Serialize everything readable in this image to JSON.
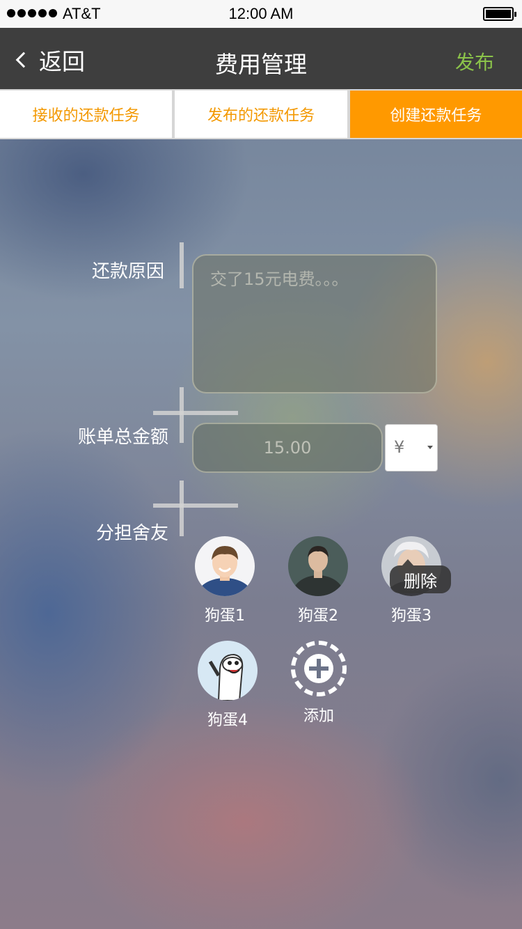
{
  "status_bar": {
    "carrier": "AT&T",
    "time": "12:00 AM"
  },
  "nav": {
    "back_label": "返回",
    "title": "费用管理",
    "publish_label": "发布"
  },
  "tabs": [
    {
      "label": "接收的还款任务",
      "active": false
    },
    {
      "label": "发布的还款任务",
      "active": false
    },
    {
      "label": "创建还款任务",
      "active": true
    }
  ],
  "form": {
    "reason_label": "还款原因",
    "reason_placeholder": "交了15元电费。。。",
    "amount_label": "账单总金额",
    "amount_placeholder": "15.00",
    "currency": "¥",
    "share_label": "分担舍友"
  },
  "roommates": [
    {
      "name": "狗蛋1",
      "avatar_color": "#4a6fa5"
    },
    {
      "name": "狗蛋2",
      "avatar_color": "#4b5d5a"
    },
    {
      "name": "狗蛋3",
      "avatar_color": "#9aa0aa"
    },
    {
      "name": "狗蛋4",
      "avatar_color": "#cfe2ef"
    }
  ],
  "delete_tooltip": "删除",
  "add_label": "添加",
  "colors": {
    "accent": "#ff9900",
    "publish": "#8bc34a",
    "nav_bg": "#3e3e3e"
  }
}
